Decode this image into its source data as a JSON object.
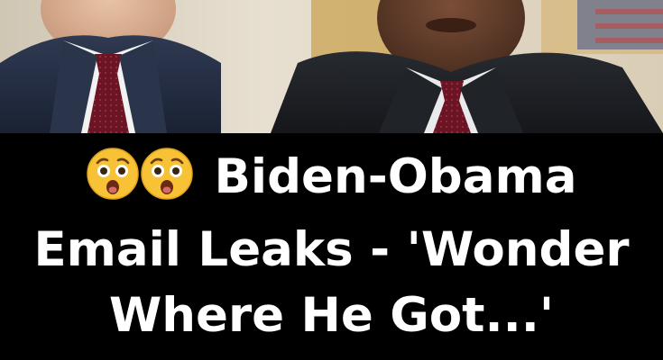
{
  "headline": {
    "line1": "Biden-Obama",
    "line2": "Email Leaks - 'Wonder",
    "line3": "Where He Got...'"
  },
  "emoji": {
    "name": "astonished-face",
    "count": 2
  },
  "colors": {
    "background": "#000000",
    "text": "#ffffff",
    "emoji_face": "#f7c235"
  }
}
